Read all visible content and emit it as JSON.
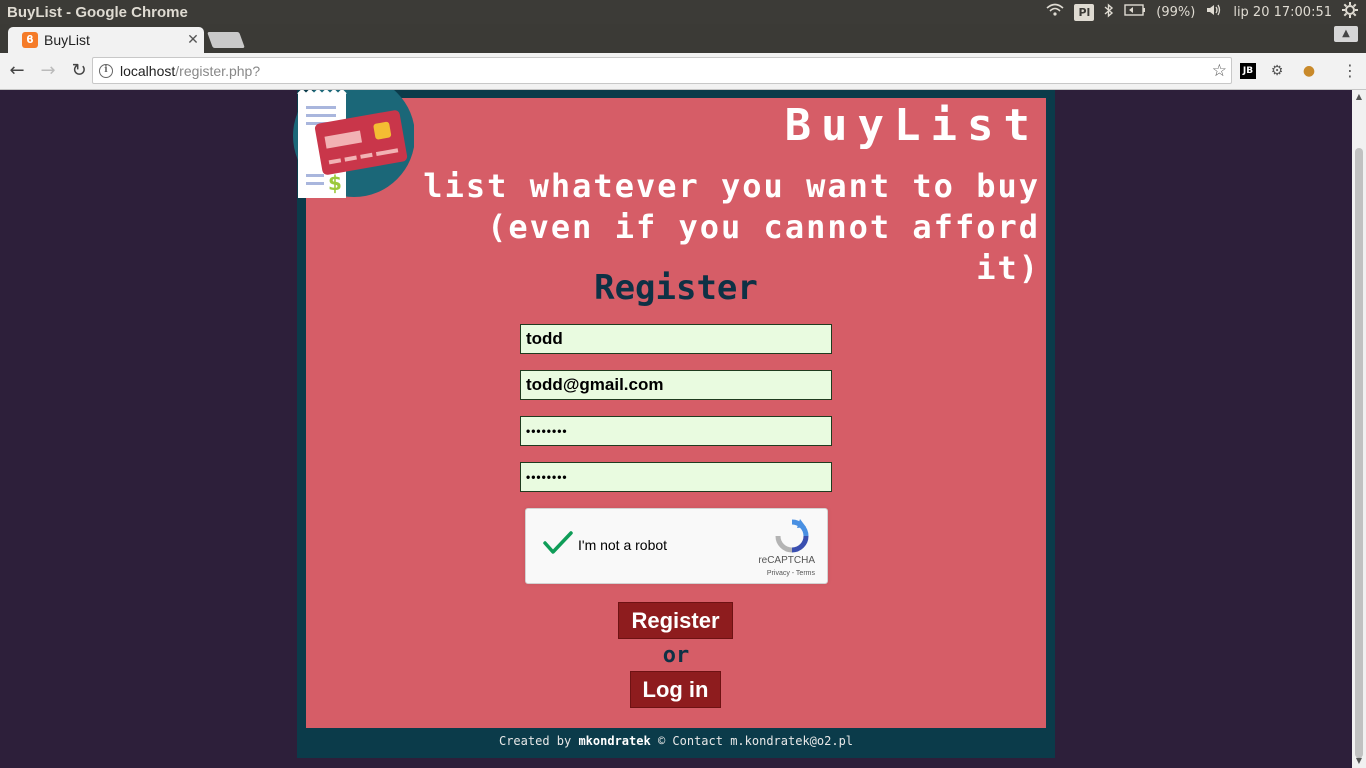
{
  "os": {
    "window_title": "BuyList - Google Chrome",
    "keyboard": "Pl",
    "battery": "(99%)",
    "datetime": "lip 20 17:00:51"
  },
  "browser": {
    "tab_title": "BuyList",
    "url_host": "localhost",
    "url_path": "/register.php?",
    "ext_jb": "JB"
  },
  "page": {
    "brand": "BuyList",
    "tagline_line1": "list whatever you want to buy",
    "tagline_line2": "(even if you cannot afford it)",
    "form_title": "Register",
    "username_value": "todd",
    "email_value": "todd@gmail.com",
    "password_value": "••••••••",
    "password_repeat_value": "••••••••",
    "captcha_label": "I'm not a robot",
    "captcha_brand": "reCAPTCHA",
    "captcha_links": "Privacy - Terms",
    "register_button": "Register",
    "or_text": "or",
    "login_button": "Log in",
    "footer_created_by": "Created by",
    "footer_author": "mkondratek",
    "footer_copyright": "©",
    "footer_contact": "Contact m.kondratek@o2.pl"
  },
  "colors": {
    "page_bg": "#2d1f3a",
    "frame": "#0b3b4a",
    "card": "#d65d67",
    "button": "#8e1c1e",
    "field_bg": "#e9fbe0",
    "heading": "#0e3145"
  }
}
